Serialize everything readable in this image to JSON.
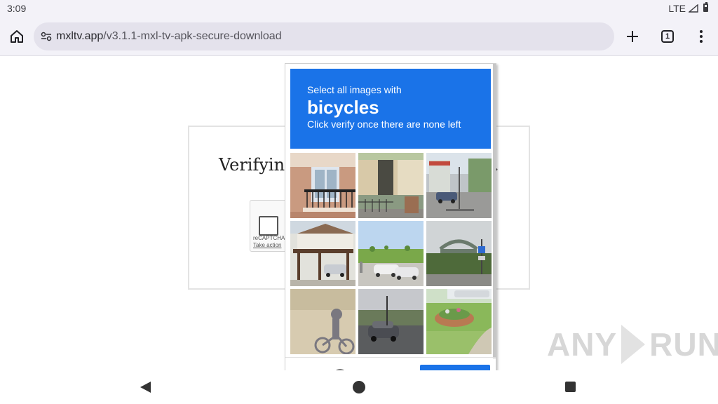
{
  "status": {
    "time": "3:09",
    "network": "LTE"
  },
  "browser": {
    "url_domain": "mxltv.app",
    "url_path": "/v3.1.1-mxl-tv-apk-secure-download",
    "tab_count": "1"
  },
  "page": {
    "verify_text": "Verifyin",
    "verify_trail": ".",
    "recaptcha_label": "reCAPTCHA",
    "recaptcha_action": "Take action"
  },
  "challenge": {
    "instruction": "Select all images with",
    "target": "bicycles",
    "hint": "Click verify once there are none left",
    "tiles": [
      {
        "name": "tile-balcony"
      },
      {
        "name": "tile-house-entrance"
      },
      {
        "name": "tile-street-car"
      },
      {
        "name": "tile-carport"
      },
      {
        "name": "tile-parked-cars-field"
      },
      {
        "name": "tile-bridge"
      },
      {
        "name": "tile-shadow-bicycle"
      },
      {
        "name": "tile-car-road"
      },
      {
        "name": "tile-garden-car"
      }
    ]
  },
  "watermark": {
    "left": "ANY",
    "right": "RUN"
  },
  "colors": {
    "accent": "#1a73e8"
  }
}
